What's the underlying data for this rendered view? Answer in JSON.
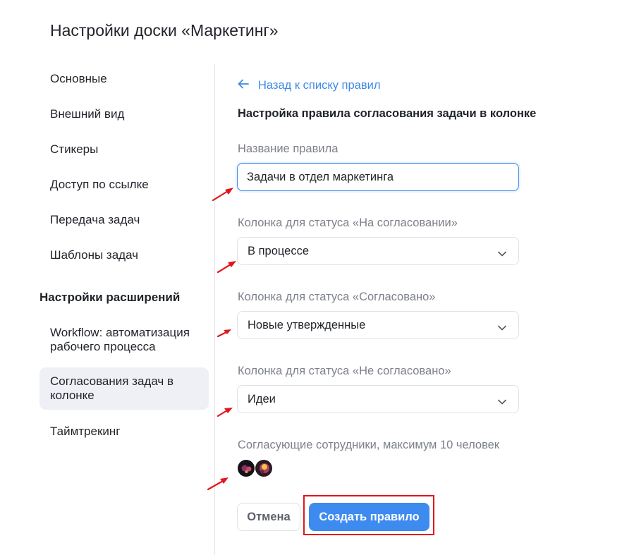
{
  "page": {
    "title": "Настройки доски «Маркетинг»"
  },
  "sidebar": {
    "items": [
      {
        "label": "Основные"
      },
      {
        "label": "Внешний вид"
      },
      {
        "label": "Стикеры"
      },
      {
        "label": "Доступ по ссылке"
      },
      {
        "label": "Передача задач"
      },
      {
        "label": "Шаблоны задач"
      }
    ],
    "section_title": "Настройки расширений",
    "extensions": [
      {
        "label": "Workflow: автоматизация рабочего процесса",
        "active": false
      },
      {
        "label": "Согласования задач в колонке",
        "active": true
      },
      {
        "label": "Таймтрекинг",
        "active": false
      }
    ]
  },
  "main": {
    "back_link": "Назад к списку правил",
    "heading": "Настройка правила согласования задачи в колонке",
    "rule_name": {
      "label": "Название правила",
      "value": "Задачи в отдел маркетинга"
    },
    "status_pending": {
      "label": "Колонка для статуса «На согласовании»",
      "value": "В процессе"
    },
    "status_approved": {
      "label": "Колонка для статуса «Согласовано»",
      "value": "Новые утвержденные"
    },
    "status_rejected": {
      "label": "Колонка для статуса «Не согласовано»",
      "value": "Идеи"
    },
    "approvers": {
      "label": "Согласующие сотрудники, максимум 10 человек",
      "count": 2
    },
    "cancel_label": "Отмена",
    "create_label": "Создать правило"
  },
  "colors": {
    "accent": "#3e8bf0",
    "link": "#3c89e8",
    "active_bg": "#eff0f5",
    "annotation_red": "#e0161c"
  },
  "icons": {
    "back": "arrow-left-icon",
    "dropdown": "chevron-down-icon",
    "annotation": "red-arrow-icon"
  }
}
